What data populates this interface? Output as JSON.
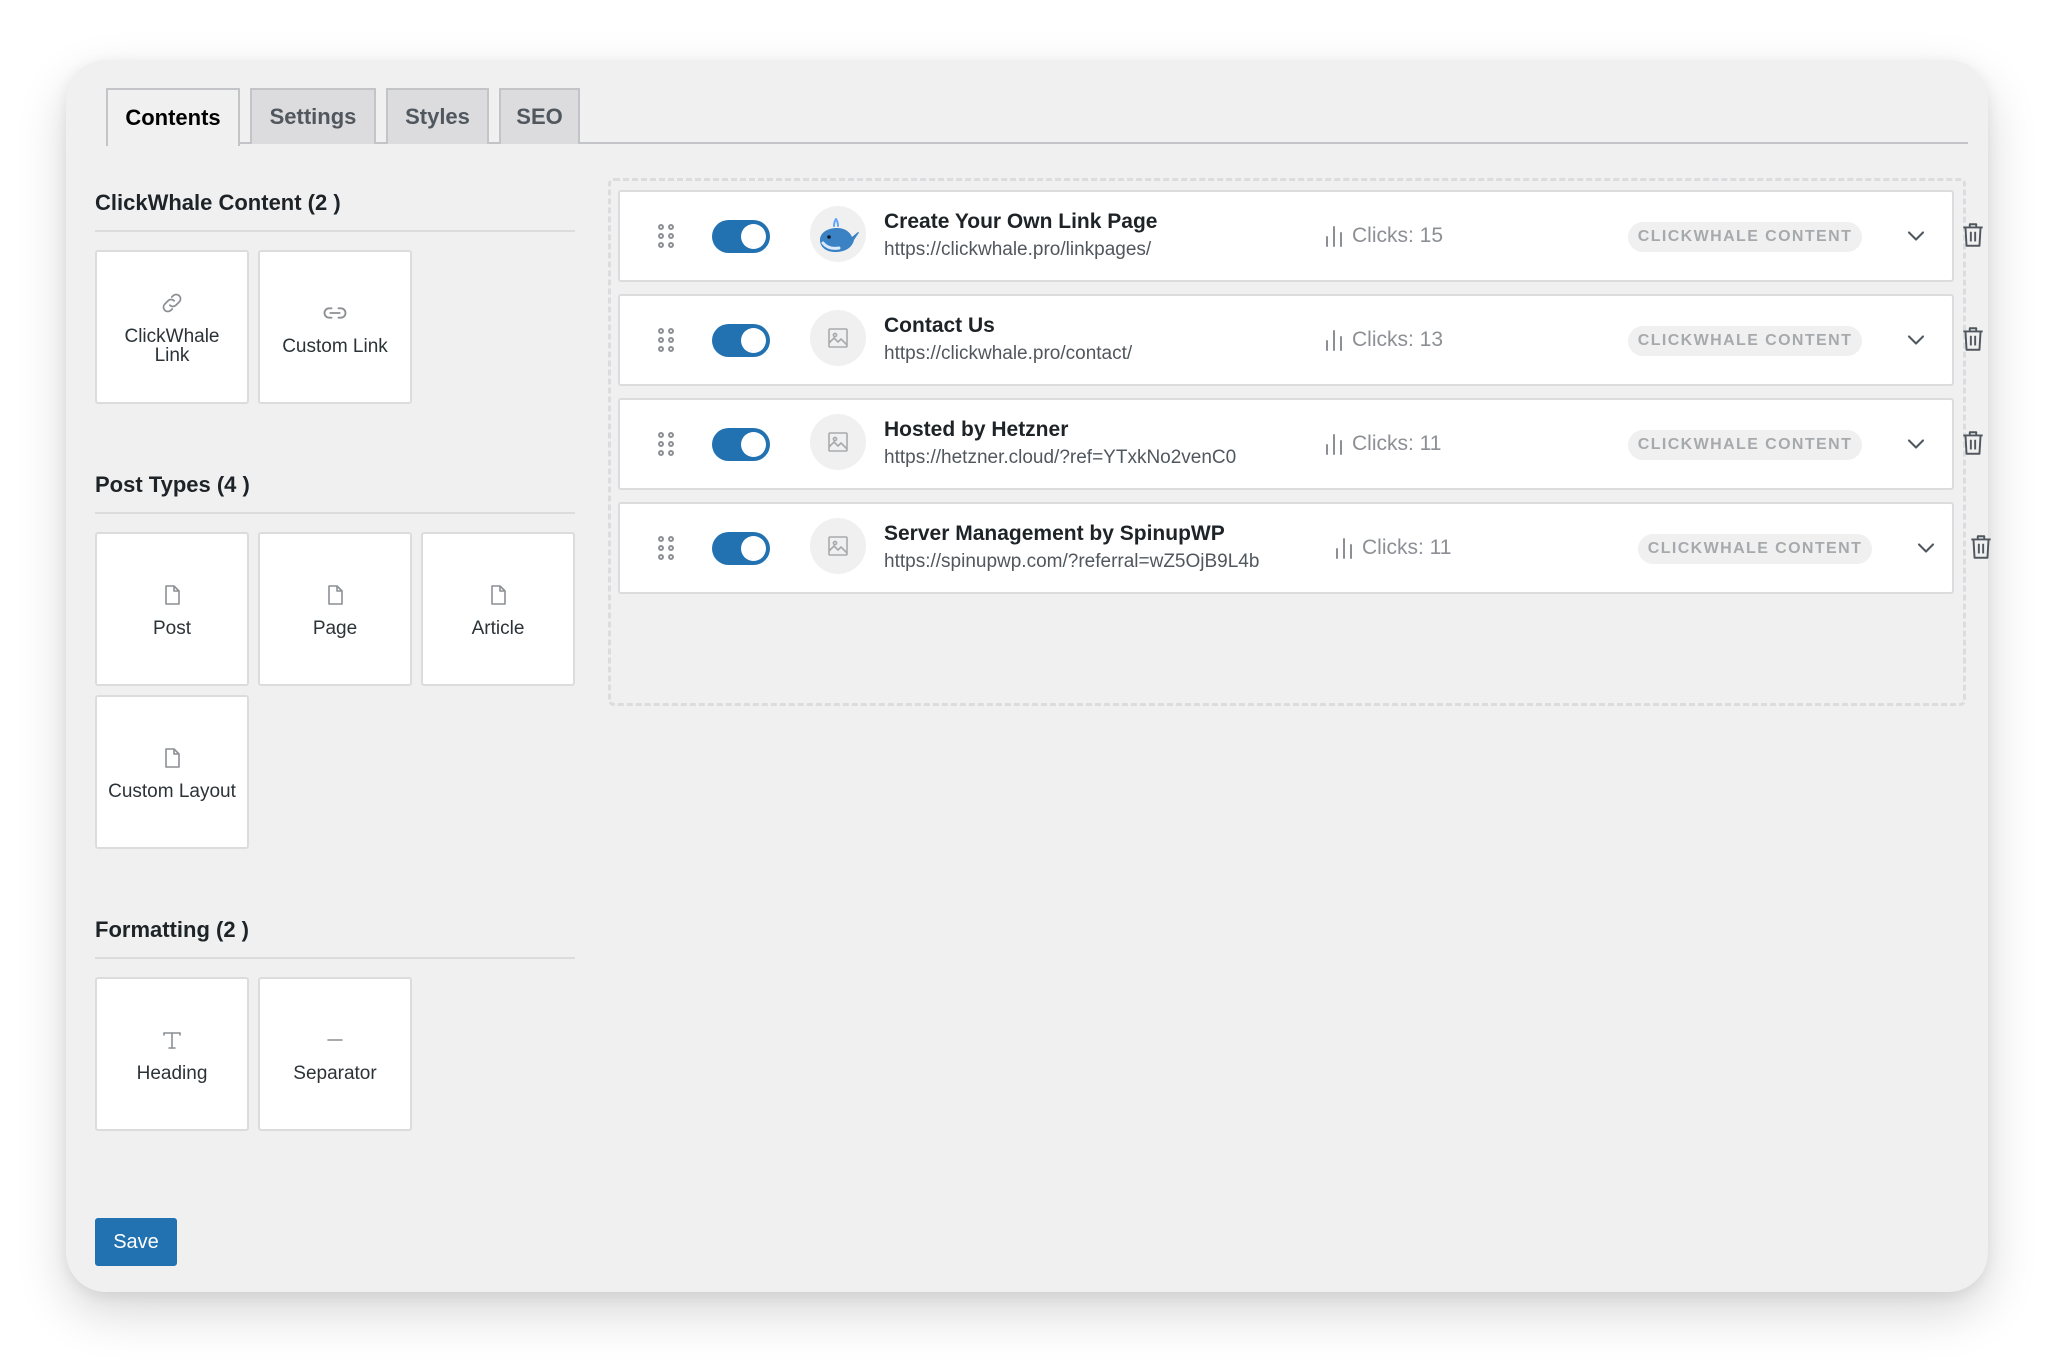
{
  "tabs": [
    {
      "label": "Contents",
      "active": true
    },
    {
      "label": "Settings",
      "active": false
    },
    {
      "label": "Styles",
      "active": false
    },
    {
      "label": "SEO",
      "active": false
    }
  ],
  "sidebar": {
    "clickwhale_content": {
      "title": "ClickWhale Content (2 )",
      "items": [
        {
          "label": "ClickWhale Link",
          "icon": "link-icon"
        },
        {
          "label": "Custom Link",
          "icon": "chain-link-icon"
        }
      ]
    },
    "post_types": {
      "title": "Post Types (4 )",
      "items": [
        {
          "label": "Post",
          "icon": "document-icon"
        },
        {
          "label": "Page",
          "icon": "document-icon"
        },
        {
          "label": "Article",
          "icon": "document-icon"
        },
        {
          "label": "Custom Layout",
          "icon": "document-icon"
        }
      ]
    },
    "formatting": {
      "title": "Formatting (2 )",
      "items": [
        {
          "label": "Heading",
          "icon": "heading-t-icon"
        },
        {
          "label": "Separator",
          "icon": "separator-dash-icon"
        }
      ]
    }
  },
  "links": [
    {
      "title": "Create Your Own Link Page",
      "url": "https://clickwhale.pro/linkpages/",
      "clicks": "Clicks: 15",
      "badge": "CLICKWHALE CONTENT",
      "enabled": true,
      "thumb": "whale-logo-icon"
    },
    {
      "title": "Contact Us",
      "url": "https://clickwhale.pro/contact/",
      "clicks": "Clicks: 13",
      "badge": "CLICKWHALE CONTENT",
      "enabled": true,
      "thumb": "image-placeholder-icon"
    },
    {
      "title": "Hosted by Hetzner",
      "url": "https://hetzner.cloud/?ref=YTxkNo2venC0",
      "clicks": "Clicks: 11",
      "badge": "CLICKWHALE CONTENT",
      "enabled": true,
      "thumb": "image-placeholder-icon"
    },
    {
      "title": "Server Management by SpinupWP",
      "url": "https://spinupwp.com/?referral=wZ5OjB9L4b",
      "clicks": "Clicks: 11",
      "badge": "CLICKWHALE CONTENT",
      "enabled": true,
      "thumb": "image-placeholder-icon"
    }
  ],
  "save_label": "Save",
  "colors": {
    "accent": "#2271b1",
    "panel_bg": "#f0f0f1",
    "border": "#dcdcde"
  }
}
